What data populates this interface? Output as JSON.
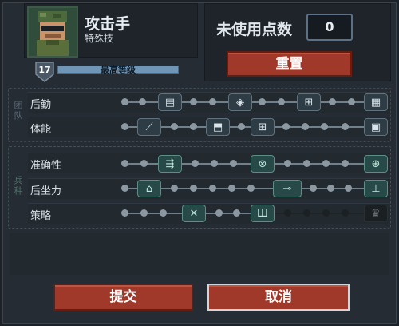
{
  "profile": {
    "name": "攻击手",
    "subclass": "特殊技",
    "level": "17",
    "level_label": "最高等级"
  },
  "points": {
    "label": "未使用点数",
    "value": "0"
  },
  "reset_label": "重置",
  "groups": {
    "team": {
      "label": "团队",
      "rows": [
        {
          "label": "后勤"
        },
        {
          "label": "体能"
        }
      ]
    },
    "arms": {
      "label": "兵种",
      "rows": [
        {
          "label": "准确性"
        },
        {
          "label": "后坐力"
        },
        {
          "label": "策略"
        }
      ]
    }
  },
  "icons": {
    "logistics": [
      "ammo-icon",
      "shield-icon",
      "medkit-icon",
      "supply-icon"
    ],
    "stamina": [
      "knife-icon",
      "boot-icon",
      "armor-icon",
      "bag-icon"
    ],
    "accuracy": [
      "bullet-icon",
      "scope-icon",
      "crosshair-icon"
    ],
    "recoil": [
      "grip-icon",
      "rifle-icon",
      "bipod-icon"
    ],
    "tactics": [
      "grenade-icon",
      "claw-icon",
      "locked-skill-icon"
    ]
  },
  "colors": {
    "accent": "#a0392a",
    "teal": "#274a48",
    "bg": "#1d2228"
  },
  "actions": {
    "submit": "提交",
    "cancel": "取消"
  }
}
